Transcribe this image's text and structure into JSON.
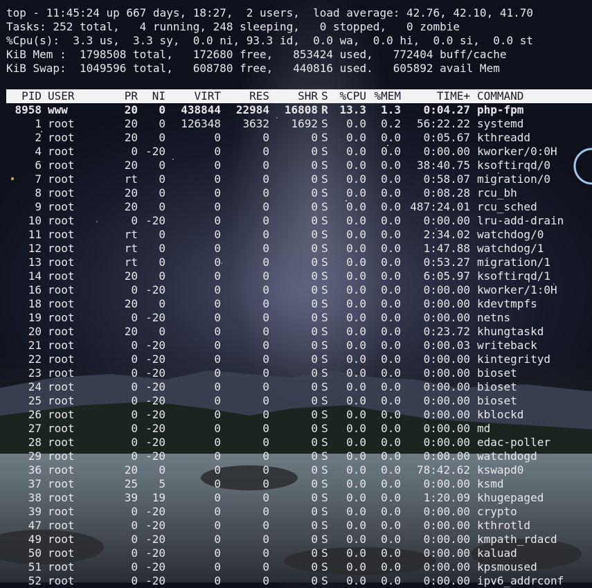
{
  "summary": {
    "line1": "top - 11:45:24 up 667 days, 18:27,  2 users,  load average: 42.76, 42.10, 41.70",
    "line2": "Tasks: 252 total,   4 running, 248 sleeping,   0 stopped,   0 zombie",
    "line3": "%Cpu(s):  3.3 us,  3.3 sy,  0.0 ni, 93.3 id,  0.0 wa,  0.0 hi,  0.0 si,  0.0 st",
    "line4": "KiB Mem :  1798508 total,   172680 free,   853424 used,   772404 buff/cache",
    "line5": "KiB Swap:  1049596 total,   608780 free,   440816 used.   605892 avail Mem"
  },
  "columns": {
    "pid": "PID",
    "user": "USER",
    "pr": "PR",
    "ni": "NI",
    "virt": "VIRT",
    "res": "RES",
    "shr": "SHR",
    "s": "S",
    "cpu": "%CPU",
    "mem": "%MEM",
    "time": "TIME+",
    "cmd": "COMMAND"
  },
  "processes": [
    [
      "8958",
      "www",
      "20",
      "0",
      "438844",
      "22984",
      "16808",
      "R",
      "13.3",
      "1.3",
      "0:04.27",
      "php-fpm"
    ],
    [
      "1",
      "root",
      "20",
      "0",
      "126348",
      "3632",
      "1692",
      "S",
      "0.0",
      "0.2",
      "56:22.22",
      "systemd"
    ],
    [
      "2",
      "root",
      "20",
      "0",
      "0",
      "0",
      "0",
      "S",
      "0.0",
      "0.0",
      "0:05.67",
      "kthreadd"
    ],
    [
      "4",
      "root",
      "0",
      "-20",
      "0",
      "0",
      "0",
      "S",
      "0.0",
      "0.0",
      "0:00.00",
      "kworker/0:0H"
    ],
    [
      "6",
      "root",
      "20",
      "0",
      "0",
      "0",
      "0",
      "S",
      "0.0",
      "0.0",
      "38:40.75",
      "ksoftirqd/0"
    ],
    [
      "7",
      "root",
      "rt",
      "0",
      "0",
      "0",
      "0",
      "S",
      "0.0",
      "0.0",
      "0:58.07",
      "migration/0"
    ],
    [
      "8",
      "root",
      "20",
      "0",
      "0",
      "0",
      "0",
      "S",
      "0.0",
      "0.0",
      "0:08.28",
      "rcu_bh"
    ],
    [
      "9",
      "root",
      "20",
      "0",
      "0",
      "0",
      "0",
      "S",
      "0.0",
      "0.0",
      "487:24.01",
      "rcu_sched"
    ],
    [
      "10",
      "root",
      "0",
      "-20",
      "0",
      "0",
      "0",
      "S",
      "0.0",
      "0.0",
      "0:00.00",
      "lru-add-drain"
    ],
    [
      "11",
      "root",
      "rt",
      "0",
      "0",
      "0",
      "0",
      "S",
      "0.0",
      "0.0",
      "2:34.02",
      "watchdog/0"
    ],
    [
      "12",
      "root",
      "rt",
      "0",
      "0",
      "0",
      "0",
      "S",
      "0.0",
      "0.0",
      "1:47.88",
      "watchdog/1"
    ],
    [
      "13",
      "root",
      "rt",
      "0",
      "0",
      "0",
      "0",
      "S",
      "0.0",
      "0.0",
      "0:53.27",
      "migration/1"
    ],
    [
      "14",
      "root",
      "20",
      "0",
      "0",
      "0",
      "0",
      "S",
      "0.0",
      "0.0",
      "6:05.97",
      "ksoftirqd/1"
    ],
    [
      "16",
      "root",
      "0",
      "-20",
      "0",
      "0",
      "0",
      "S",
      "0.0",
      "0.0",
      "0:00.00",
      "kworker/1:0H"
    ],
    [
      "18",
      "root",
      "20",
      "0",
      "0",
      "0",
      "0",
      "S",
      "0.0",
      "0.0",
      "0:00.00",
      "kdevtmpfs"
    ],
    [
      "19",
      "root",
      "0",
      "-20",
      "0",
      "0",
      "0",
      "S",
      "0.0",
      "0.0",
      "0:00.00",
      "netns"
    ],
    [
      "20",
      "root",
      "20",
      "0",
      "0",
      "0",
      "0",
      "S",
      "0.0",
      "0.0",
      "0:23.72",
      "khungtaskd"
    ],
    [
      "21",
      "root",
      "0",
      "-20",
      "0",
      "0",
      "0",
      "S",
      "0.0",
      "0.0",
      "0:00.03",
      "writeback"
    ],
    [
      "22",
      "root",
      "0",
      "-20",
      "0",
      "0",
      "0",
      "S",
      "0.0",
      "0.0",
      "0:00.00",
      "kintegrityd"
    ],
    [
      "23",
      "root",
      "0",
      "-20",
      "0",
      "0",
      "0",
      "S",
      "0.0",
      "0.0",
      "0:00.00",
      "bioset"
    ],
    [
      "24",
      "root",
      "0",
      "-20",
      "0",
      "0",
      "0",
      "S",
      "0.0",
      "0.0",
      "0:00.00",
      "bioset"
    ],
    [
      "25",
      "root",
      "0",
      "-20",
      "0",
      "0",
      "0",
      "S",
      "0.0",
      "0.0",
      "0:00.00",
      "bioset"
    ],
    [
      "26",
      "root",
      "0",
      "-20",
      "0",
      "0",
      "0",
      "S",
      "0.0",
      "0.0",
      "0:00.00",
      "kblockd"
    ],
    [
      "27",
      "root",
      "0",
      "-20",
      "0",
      "0",
      "0",
      "S",
      "0.0",
      "0.0",
      "0:00.00",
      "md"
    ],
    [
      "28",
      "root",
      "0",
      "-20",
      "0",
      "0",
      "0",
      "S",
      "0.0",
      "0.0",
      "0:00.00",
      "edac-poller"
    ],
    [
      "29",
      "root",
      "0",
      "-20",
      "0",
      "0",
      "0",
      "S",
      "0.0",
      "0.0",
      "0:00.00",
      "watchdogd"
    ],
    [
      "36",
      "root",
      "20",
      "0",
      "0",
      "0",
      "0",
      "S",
      "0.0",
      "0.0",
      "78:42.62",
      "kswapd0"
    ],
    [
      "37",
      "root",
      "25",
      "5",
      "0",
      "0",
      "0",
      "S",
      "0.0",
      "0.0",
      "0:00.00",
      "ksmd"
    ],
    [
      "38",
      "root",
      "39",
      "19",
      "0",
      "0",
      "0",
      "S",
      "0.0",
      "0.0",
      "1:20.09",
      "khugepaged"
    ],
    [
      "39",
      "root",
      "0",
      "-20",
      "0",
      "0",
      "0",
      "S",
      "0.0",
      "0.0",
      "0:00.00",
      "crypto"
    ],
    [
      "47",
      "root",
      "0",
      "-20",
      "0",
      "0",
      "0",
      "S",
      "0.0",
      "0.0",
      "0:00.00",
      "kthrotld"
    ],
    [
      "49",
      "root",
      "0",
      "-20",
      "0",
      "0",
      "0",
      "S",
      "0.0",
      "0.0",
      "0:00.00",
      "kmpath_rdacd"
    ],
    [
      "50",
      "root",
      "0",
      "-20",
      "0",
      "0",
      "0",
      "S",
      "0.0",
      "0.0",
      "0:00.00",
      "kaluad"
    ],
    [
      "51",
      "root",
      "0",
      "-20",
      "0",
      "0",
      "0",
      "S",
      "0.0",
      "0.0",
      "0:00.00",
      "kpsmoused"
    ],
    [
      "52",
      "root",
      "0",
      "-20",
      "0",
      "0",
      "0",
      "S",
      "0.0",
      "0.0",
      "0:00.00",
      "ipv6_addrconf"
    ]
  ]
}
